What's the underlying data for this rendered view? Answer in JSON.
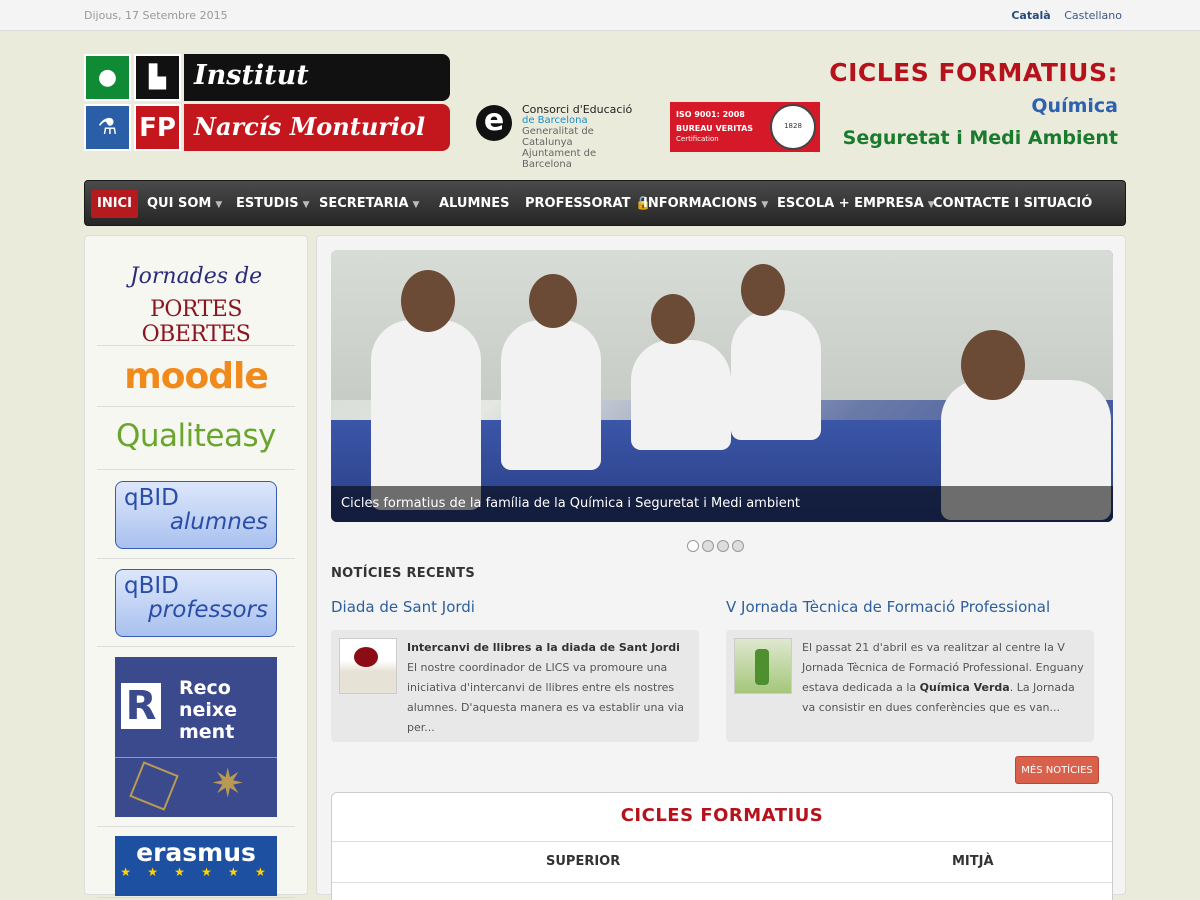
{
  "topbar": {
    "date": "Dijous, 17 Setembre 2015",
    "lang_ca": "Català",
    "lang_es": "Castellano"
  },
  "logo": {
    "line1": "Institut",
    "fp": "FP",
    "line2": "Narcís Monturiol"
  },
  "consorci": {
    "e": "e",
    "line1": "Consorci d'Educació",
    "line2": "de Barcelona",
    "line3": "Generalitat de Catalunya",
    "line4": "Ajuntament de Barcelona"
  },
  "iso": {
    "line1": "ISO 9001: 2008",
    "line2": "BUREAU VERITAS",
    "line3": "Certification",
    "seal": "1828"
  },
  "header_right": {
    "title": "CICLES FORMATIUS:",
    "sub1": "Química",
    "sub2": "Seguretat i Medi Ambient"
  },
  "nav": [
    {
      "label": "INICI"
    },
    {
      "label": "QUI SOM"
    },
    {
      "label": "ESTUDIS"
    },
    {
      "label": "SECRETARIA"
    },
    {
      "label": "ALUMNES"
    },
    {
      "label": "PROFESSORAT 🔒"
    },
    {
      "label": "INFORMACIONS"
    },
    {
      "label": "ESCOLA + EMPRESA"
    },
    {
      "label": "CONTACTE I SITUACIÓ"
    }
  ],
  "sidebar": {
    "jornades1": "Jornades de",
    "jornades2": "PORTES OBERTES",
    "moodle": "moodle",
    "qualiteasy": "Qualiteasy",
    "qbid1_a": "qBID",
    "qbid1_b": "alumnes",
    "qbid2_a": "qBID",
    "qbid2_b": "professors",
    "recon_r": "R",
    "recon_1": "Reco",
    "recon_2": "neixe",
    "recon_3": "ment",
    "erasmus": "erasmus",
    "erasmus_stars": "★ ★ ★ ★ ★ ★"
  },
  "slider": {
    "caption": "Cicles formatius de la família de la Química i Seguretat i Medi ambient"
  },
  "news": {
    "section_title": "NOTÍCIES RECENTS",
    "items": [
      {
        "title": "Diada de Sant Jordi",
        "bold": "Intercanvi de llibres a la diada de Sant Jordi",
        "text": " El nostre coordinador de LICS va promoure una iniciativa d'intercanvi de llibres entre els nostres alumnes. D'aquesta manera es va establir una via per..."
      },
      {
        "title": "V Jornada Tècnica de Formació Professional",
        "text_a": "El passat 21 d'abril es va realitzar al centre la V Jornada Tècnica de Formació Professional. Enguany estava dedicada a la ",
        "bold": "Química Verda",
        "text_b": ". La Jornada va consistir en dues conferències que es van..."
      }
    ],
    "more_button": "MÉS NOTÍCIES"
  },
  "cicles": {
    "title": "CICLES FORMATIUS",
    "col1": "SUPERIOR",
    "col2": "MITJÀ"
  }
}
